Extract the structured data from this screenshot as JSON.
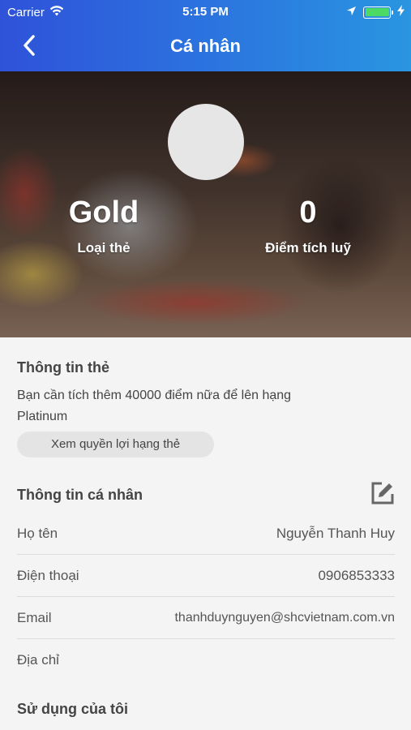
{
  "status_bar": {
    "carrier": "Carrier",
    "time": "5:15 PM",
    "battery_level": 1.0,
    "icons": [
      "wifi-icon",
      "location-arrow-icon",
      "battery-icon",
      "charging-bolt-icon"
    ]
  },
  "nav": {
    "title": "Cá nhân",
    "back_icon": "chevron-left-icon"
  },
  "profile": {
    "card_type_value": "Gold",
    "card_type_label": "Loại thẻ",
    "points_value": "0",
    "points_label": "Điểm tích luỹ"
  },
  "card_info": {
    "title": "Thông tin thẻ",
    "description": "Bạn cần tích thêm 40000 điểm nữa để lên hạng Platinum",
    "benefit_button": "Xem quyền lợi hạng thẻ"
  },
  "personal_info": {
    "title": "Thông tin cá nhân",
    "edit_icon": "edit-icon",
    "rows": [
      {
        "label": "Họ tên",
        "value": "Nguyễn Thanh Huy"
      },
      {
        "label": "Điện thoại",
        "value": "0906853333"
      },
      {
        "label": "Email",
        "value": "thanhduynguyen@shcvietnam.com.vn"
      },
      {
        "label": "Địa chỉ",
        "value": ""
      }
    ]
  },
  "usage": {
    "title": "Sử dụng của tôi"
  },
  "colors": {
    "header_gradient_start": "#2f52d9",
    "header_gradient_end": "#2a95e0",
    "background": "#f4f4f4",
    "button_bg": "#e4e4e4",
    "battery_green": "#4cd964"
  }
}
